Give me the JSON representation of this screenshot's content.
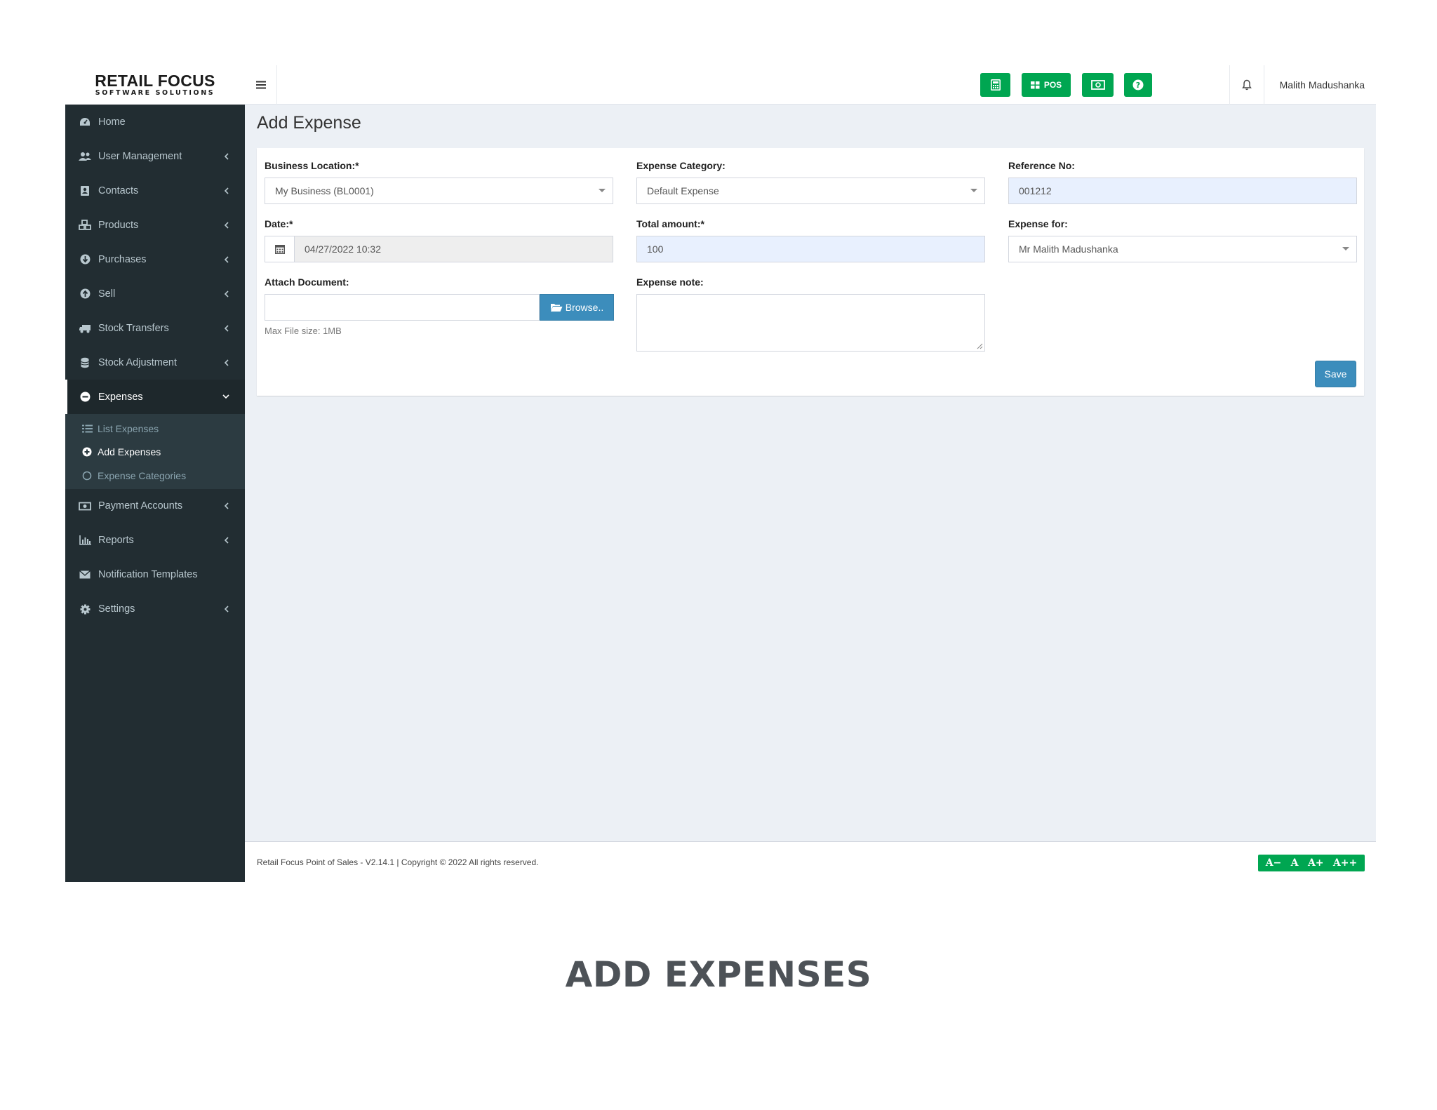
{
  "brand": {
    "main": "RETAIL FOCUS",
    "sub": "SOFTWARE SOLUTIONS"
  },
  "header": {
    "pos_label": "POS",
    "user_name": "Malith Madushanka",
    "accent": "#00a651"
  },
  "sidebar": {
    "items": [
      {
        "label": "Home",
        "icon": "dashboard-icon"
      },
      {
        "label": "User Management",
        "icon": "users-icon"
      },
      {
        "label": "Contacts",
        "icon": "address-book-icon"
      },
      {
        "label": "Products",
        "icon": "cubes-icon"
      },
      {
        "label": "Purchases",
        "icon": "arrow-circle-down-icon"
      },
      {
        "label": "Sell",
        "icon": "arrow-circle-up-icon"
      },
      {
        "label": "Stock Transfers",
        "icon": "truck-icon"
      },
      {
        "label": "Stock Adjustment",
        "icon": "database-icon"
      },
      {
        "label": "Expenses",
        "icon": "minus-circle-icon"
      },
      {
        "label": "Payment Accounts",
        "icon": "money-icon"
      },
      {
        "label": "Reports",
        "icon": "bar-chart-icon"
      },
      {
        "label": "Notification Templates",
        "icon": "envelope-icon"
      },
      {
        "label": "Settings",
        "icon": "gear-icon"
      }
    ],
    "expenses_sub": [
      {
        "label": "List Expenses"
      },
      {
        "label": "Add Expenses"
      },
      {
        "label": "Expense Categories"
      }
    ]
  },
  "page": {
    "title": "Add Expense"
  },
  "form": {
    "business_location_label": "Business Location:*",
    "business_location_value": "My Business (BL0001)",
    "expense_category_label": "Expense Category:",
    "expense_category_value": "Default Expense",
    "reference_label": "Reference No:",
    "reference_value": "001212",
    "date_label": "Date:*",
    "date_value": "04/27/2022 10:32",
    "total_label": "Total amount:*",
    "total_value": "100",
    "expense_for_label": "Expense for:",
    "expense_for_value": "Mr Malith Madushanka",
    "attach_label": "Attach Document:",
    "browse_label": "Browse..",
    "max_file_size": "Max File size: 1MB",
    "note_label": "Expense note:",
    "save_label": "Save"
  },
  "footer": {
    "text": "Retail Focus Point of Sales - V2.14.1 | Copyright © 2022 All rights reserved.",
    "font_tools": [
      "A−",
      "A",
      "A+",
      "A++"
    ]
  },
  "caption": "ADD EXPENSES"
}
